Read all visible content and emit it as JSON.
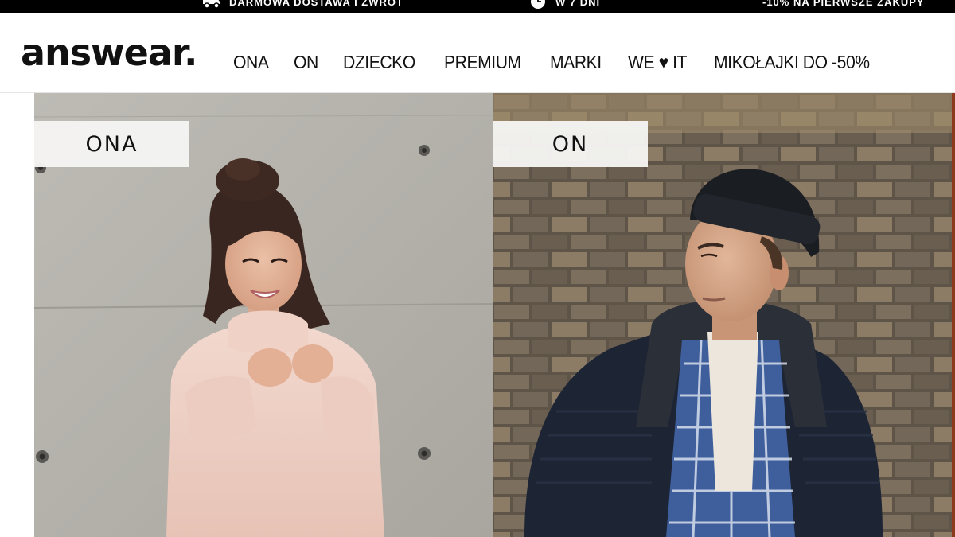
{
  "promo_bar": {
    "items": [
      {
        "icon": "truck-icon",
        "text": "DARMOWA DOSTAWA I ZWROT"
      },
      {
        "icon": "clock-icon",
        "text": "W 7 DNI"
      },
      {
        "icon": "",
        "text": "-10% NA PIERWSZE ZAKUPY"
      }
    ]
  },
  "header": {
    "logo": "answear.",
    "nav": [
      {
        "label": "ONA"
      },
      {
        "label": "ON"
      },
      {
        "label": "DZIECKO"
      },
      {
        "label": "PREMIUM"
      },
      {
        "label": "MARKI"
      },
      {
        "label": "WE ♥ IT"
      },
      {
        "label": "MIKOŁAJKI DO -50%"
      }
    ]
  },
  "hero": {
    "panels": [
      {
        "label": "ONA",
        "image": "woman-photo"
      },
      {
        "label": "ON",
        "image": "man-photo"
      }
    ]
  },
  "colors": {
    "promo_bg": "#000000",
    "text": "#111111",
    "tag_bg": "#f5f5f3"
  }
}
